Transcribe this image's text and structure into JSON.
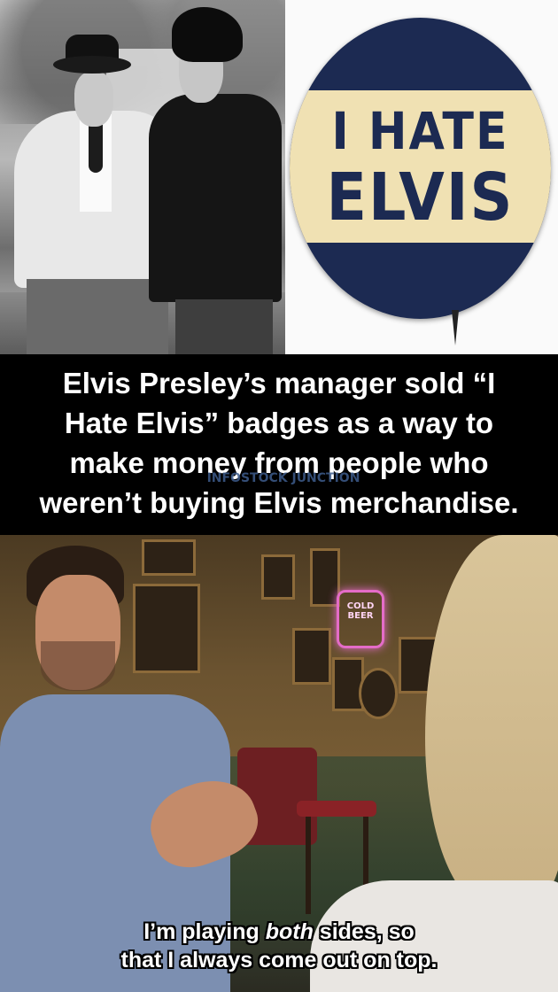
{
  "badge": {
    "line1": "I HATE",
    "line2": "ELVIS"
  },
  "caption": {
    "line1": "Elvis Presley’s manager sold “I",
    "line2": "Hate Elvis” badges as a way to",
    "line3": "make money from people who",
    "line4": "weren’t buying Elvis merchandise."
  },
  "watermark": "INFOSTOCK JUNCTION",
  "neon_sign": {
    "line1": "COLD",
    "line2": "BEER"
  },
  "subtitle": {
    "line1_before": "I’m playing ",
    "line1_emph": "both",
    "line1_after": " sides, so",
    "line2": "that I always come out on top."
  },
  "colors": {
    "badge_blue": "#1c2a52",
    "badge_band": "#f0e1b3",
    "caption_bg": "#000000",
    "watermark": "#3e5c8c"
  }
}
